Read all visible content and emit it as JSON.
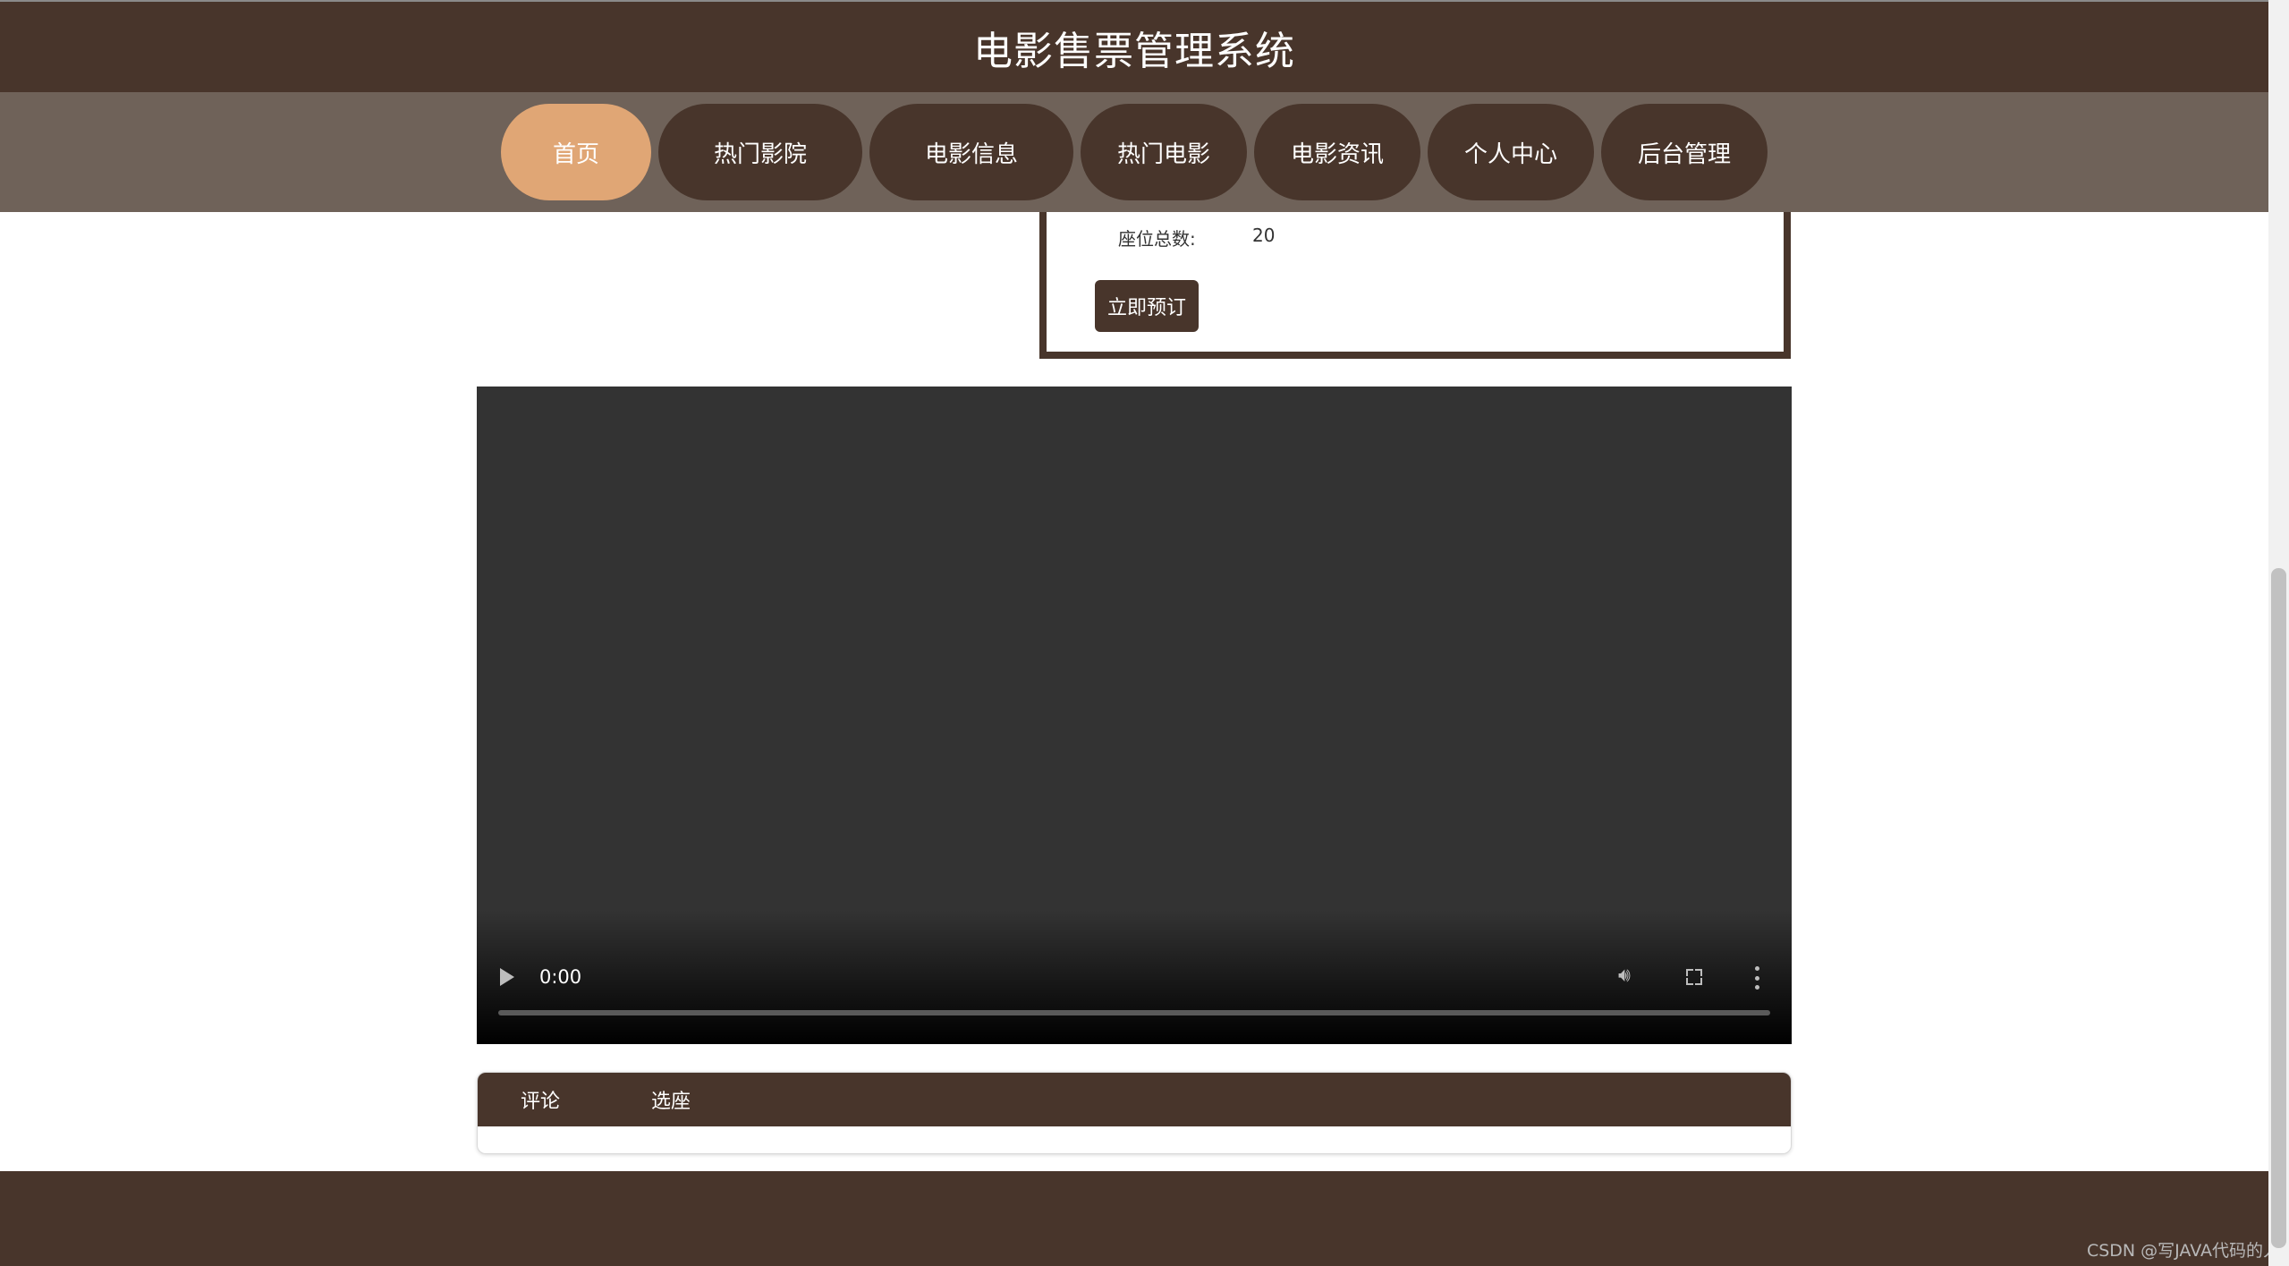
{
  "header": {
    "title": "电影售票管理系统"
  },
  "nav": {
    "items": [
      {
        "label": "首页",
        "active": true
      },
      {
        "label": "热门影院"
      },
      {
        "label": "电影信息"
      },
      {
        "label": "热门电影"
      },
      {
        "label": "电影资讯"
      },
      {
        "label": "个人中心"
      },
      {
        "label": "后台管理"
      }
    ]
  },
  "info": {
    "seat_label": "座位总数:",
    "seat_value": "20",
    "book_label": "立即预订"
  },
  "video": {
    "time": "0:00",
    "progress": 0
  },
  "tabs": [
    {
      "label": "评论"
    },
    {
      "label": "选座"
    }
  ],
  "watermark": "CSDN @写JAVA代码的人",
  "colors": {
    "primary": "#48352b",
    "accent": "#e0a675",
    "nav_bg": "#6f6259"
  }
}
